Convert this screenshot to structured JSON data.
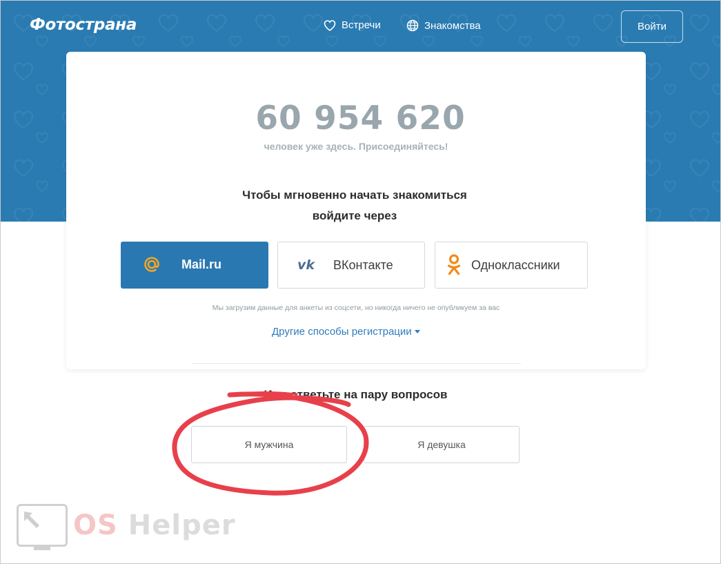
{
  "header": {
    "logo": "Фотострана",
    "nav": [
      {
        "label": "Встречи",
        "icon": "heart-outline-icon"
      },
      {
        "label": "Знакомства",
        "icon": "globe-icon"
      }
    ],
    "login_label": "Войти"
  },
  "stats": {
    "members_count": "60 954 620",
    "members_caption": "человек уже здесь. Присоединяйтесь!"
  },
  "signin": {
    "lead_line1": "Чтобы мгновенно начать знакомиться",
    "lead_line2": "войдите через",
    "providers": [
      {
        "label": "Mail.ru",
        "icon": "at-sign-icon"
      },
      {
        "label": "ВКонтакте",
        "icon": "vk-icon"
      },
      {
        "label": "Одноклассники",
        "icon": "ok-icon"
      }
    ],
    "disclaimer": "Мы загрузим данные для анкеты из соцсети, но никогда ничего не опубликуем за вас",
    "other_ways": "Другие способы регистрации"
  },
  "quiz": {
    "title": "Или ответьте на пару вопросов",
    "options": [
      "Я мужчина",
      "Я девушка"
    ]
  },
  "watermark": {
    "part1": "OS",
    "part2": "Helper"
  },
  "colors": {
    "hero_bg": "#2a7bb2",
    "mail_button": "#2a78b2",
    "link": "#2f7bbd",
    "ok_orange": "#f28a16",
    "annotation_red": "#e8404b"
  }
}
